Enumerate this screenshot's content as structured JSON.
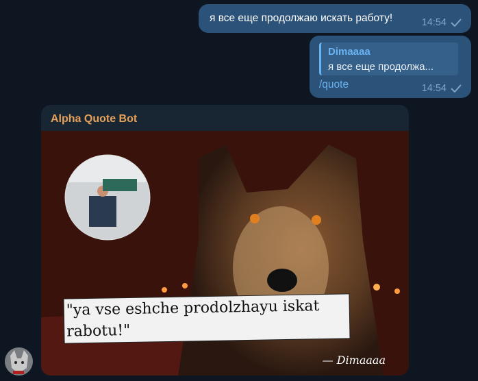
{
  "messages": {
    "outgoing_1": {
      "text": "я все еще продолжаю искать работу!",
      "time": "14:54",
      "status": "read"
    },
    "outgoing_2": {
      "reply_author": "Dimaaaa",
      "reply_snippet": "я все еще продолжа...",
      "text": "/quote",
      "time": "14:54",
      "status": "read"
    }
  },
  "bot_message": {
    "sender": "Alpha Quote Bot",
    "quote_image": {
      "quote_text": "\"ya vse eshche prodolzhayu iskat rabotu!\"",
      "signature": "— Dimaaaa"
    }
  },
  "avatar": {
    "icon": "wolf-avatar-icon"
  },
  "colors": {
    "background": "#0e1621",
    "outgoing_bubble": "#2b5278",
    "bot_name": "#e6a15a",
    "accent": "#6ab3f3"
  }
}
